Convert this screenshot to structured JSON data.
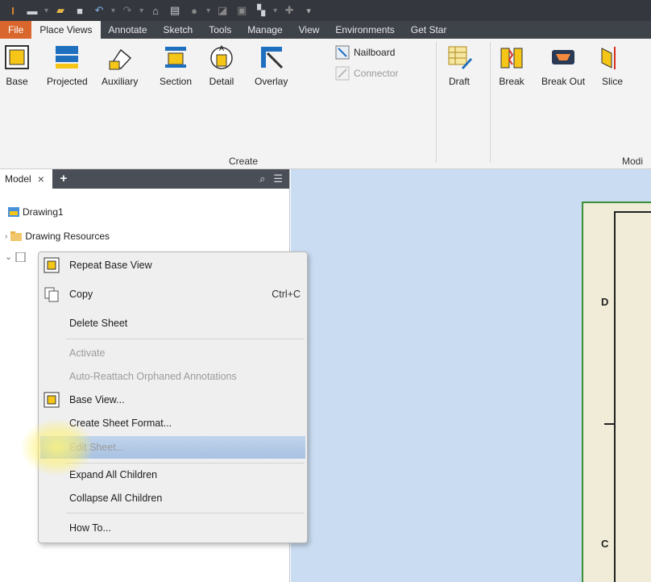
{
  "quick_access": {
    "icons": [
      "app-logo-icon",
      "new-icon",
      "open-icon",
      "save-icon",
      "undo-icon",
      "redo-icon",
      "home-icon",
      "print-icon",
      "update-icon",
      "measure-icon",
      "image-icon",
      "select-icon",
      "customize-icon"
    ]
  },
  "ribbon_tabs": [
    {
      "label": "File"
    },
    {
      "label": "Place Views"
    },
    {
      "label": "Annotate"
    },
    {
      "label": "Sketch"
    },
    {
      "label": "Tools"
    },
    {
      "label": "Manage"
    },
    {
      "label": "View"
    },
    {
      "label": "Environments"
    },
    {
      "label": "Get Star"
    }
  ],
  "ribbon": {
    "buttons": [
      {
        "label": "Base",
        "icon": "base-view-icon"
      },
      {
        "label": "Projected",
        "icon": "projected-view-icon"
      },
      {
        "label": "Auxiliary",
        "icon": "auxiliary-view-icon"
      },
      {
        "label": "Section",
        "icon": "section-view-icon"
      },
      {
        "label": "Detail",
        "icon": "detail-view-icon"
      },
      {
        "label": "Overlay",
        "icon": "overlay-view-icon"
      },
      {
        "label": "Draft",
        "icon": "draft-view-icon"
      },
      {
        "label": "Break",
        "icon": "break-icon"
      },
      {
        "label": "Break Out",
        "icon": "break-out-icon"
      },
      {
        "label": "Slice",
        "icon": "slice-icon"
      }
    ],
    "small_buttons": [
      {
        "label": "Nailboard",
        "icon": "nailboard-icon"
      },
      {
        "label": "Connector",
        "icon": "connector-icon"
      }
    ],
    "group_create": "Create",
    "group_modify": "Modi"
  },
  "browser": {
    "tab_label": "Model",
    "close": "×",
    "plus": "+",
    "tree": [
      {
        "label": "Drawing1"
      },
      {
        "label": "Drawing Resources"
      }
    ]
  },
  "canvas": {
    "zone_d": "D",
    "zone_c": "C"
  },
  "context_menu": {
    "items": [
      {
        "label": "Repeat Base View",
        "shortcut": "",
        "icon": "base-view-icon"
      },
      {
        "label": "Copy",
        "shortcut": "Ctrl+C",
        "icon": "copy-icon"
      },
      {
        "label": "Delete Sheet",
        "shortcut": ""
      },
      {
        "label": "Activate",
        "shortcut": ""
      },
      {
        "label": "Auto-Reattach Orphaned Annotations",
        "shortcut": ""
      },
      {
        "label": "Base View...",
        "shortcut": "",
        "icon": "base-view-icon"
      },
      {
        "label": "Create Sheet Format...",
        "shortcut": ""
      },
      {
        "label": "Edit Sheet...",
        "shortcut": ""
      },
      {
        "label": "Expand All Children",
        "shortcut": ""
      },
      {
        "label": "Collapse All Children",
        "shortcut": ""
      },
      {
        "label": "How To...",
        "shortcut": ""
      }
    ]
  },
  "colors": {
    "file_tab": "#d9662c",
    "canvas_bg": "#c9dcf1",
    "sheet_bg": "#f0ecd7",
    "sheet_border": "#3b8f3b",
    "menu_highlight": "#a8c2e2"
  }
}
